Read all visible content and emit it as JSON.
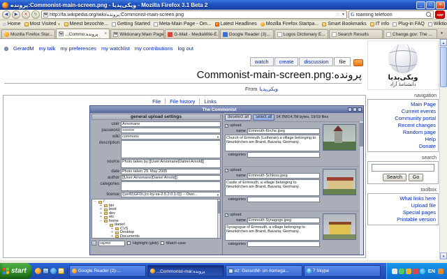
{
  "colors": {
    "link_blue": "#002bb8",
    "titlebar_blue": "#1e50c0",
    "taskbar_blue": "#2257c5",
    "start_green": "#2f8b29",
    "abp_red": "#d40000",
    "rss_orange": "#f07010"
  },
  "icons": {
    "wikipedia": "W",
    "google": "G",
    "skype": "S",
    "back": "◀",
    "forward": "▶",
    "reload": "↻",
    "stop": "✕",
    "dropdown": "▼",
    "star": "☆",
    "home": "⌂",
    "overflow": "»",
    "tab_list": "▼",
    "close": "×",
    "scroll_up": "▲",
    "scroll_down": "▼",
    "check": "✓",
    "minimize": "_",
    "maximize": "□",
    "win_close": "✕"
  },
  "window": {
    "title": "پرونده:Commonist-main-screen.png - ویکی‌پدیا - Mozilla Firefox 3.1 Beta 2"
  },
  "nav": {
    "url": "http://fa.wikipedia.org/wiki/پرونده:Commonist-main-screen.png",
    "search_value": "roaming telefoon",
    "abp": "ABP"
  },
  "bookmarks": {
    "items": [
      {
        "label": "Home"
      },
      {
        "label": "Most Visited"
      },
      {
        "label": "Meest bezochte..."
      },
      {
        "label": "Getting Started"
      },
      {
        "label": "Meta-Main Page - Om..."
      },
      {
        "label": "Latest Headlines"
      },
      {
        "label": "Mozilla Firefox Startpa..."
      },
      {
        "label": "Smart Bookmarks"
      },
      {
        "label": "IT info"
      },
      {
        "label": "Plug-in FAQ"
      },
      {
        "label": "WiktionaryZ"
      }
    ]
  },
  "tabs": {
    "items": [
      {
        "label": "Mozilla Firefox Star..."
      },
      {
        "label": "پرونده:Commo..."
      },
      {
        "label": "Wiktionary:Main Page..."
      },
      {
        "label": "G-Mail - MediaWiki-E..."
      },
      {
        "label": "Google Reader (3)..."
      },
      {
        "label": "Logos Dictionary E..."
      },
      {
        "label": "Search Results"
      },
      {
        "label": "Change.gov: The ..."
      }
    ]
  },
  "page": {
    "personal": [
      "GerardM",
      "my talk",
      "my preferences",
      "my watchlist",
      "my contributions",
      "log out"
    ],
    "content_tabs": [
      "watch",
      "create",
      "discussion",
      "file"
    ],
    "title": "پرونده:Commonist-main-screen.png",
    "from_label": "From",
    "site_name": "ویکی‌پدیا",
    "file_links": [
      "File",
      "File history",
      "Links"
    ]
  },
  "sidebar": {
    "wordmark": "ویکی‌پدیا",
    "tagline": "دانشنامهٔ آزاد",
    "nav_title": "navigation",
    "nav_items": [
      "Main Page",
      "Current events",
      "Community portal",
      "Recent changes",
      "Random page",
      "Help",
      "Donate"
    ],
    "search_title": "search",
    "search_button": "Search",
    "go_button": "Go",
    "toolbox_title": "toolbox",
    "toolbox_items": [
      "What links here",
      "Upload file",
      "Special pages",
      "Printable version"
    ]
  },
  "commonist": {
    "title": "The Commonist",
    "settings_header": "general upload settings",
    "fields": [
      {
        "label": "user",
        "value": "Arnomane"
      },
      {
        "label": "password",
        "value": "•••••••••"
      },
      {
        "label": "wiki",
        "value": "commons"
      },
      {
        "label": "description",
        "value": ""
      },
      {
        "label": "source",
        "value": "Photo taken by [[User:Arnomane|Daniel Arnold]]"
      },
      {
        "label": "date",
        "value": "Photo taken 29. May 2005"
      },
      {
        "label": "author",
        "value": "[[User:Arnomane|Daniel Arnold]]"
      },
      {
        "label": "categories",
        "value": ""
      },
      {
        "label": "license",
        "value": "{{self2|GFDL|cc-by-sa-2.5,2.0,1.0}} -- Own..."
      }
    ],
    "tree": [
      {
        "label": "/",
        "knob": "−"
      },
      {
        "label": "bin",
        "knob": "+"
      },
      {
        "label": "boot",
        "knob": "+"
      },
      {
        "label": "dev",
        "knob": "+"
      },
      {
        "label": "etc",
        "knob": "+"
      },
      {
        "label": "home",
        "knob": "−"
      },
      {
        "label": "daniel",
        "knob": "−"
      },
      {
        "label": "CVS",
        "knob": "+"
      },
      {
        "label": "Desktop",
        "knob": "+"
      },
      {
        "label": "Documents",
        "knob": "+"
      }
    ],
    "filter": {
      "value": "raymo",
      "highlight_label": "Highlight (glob)",
      "match_label": "Match case"
    },
    "toolbar": {
      "deselect_all": "deselect all",
      "select_all": "select all",
      "status": "14.7M/14.7M bytes, 19/19 files"
    },
    "labels": {
      "upload": "upload",
      "name": "name",
      "categories": "categories"
    },
    "files": [
      {
        "name": "Ermreuth-Kirche.jpeg",
        "description": "Church of Ermreuth (Lutheran) a village belonging to Neunkirchen am Brand, Bavaria, Germany."
      },
      {
        "name": "Ermreuth-Schloss.jpeg",
        "description": "Castle of Ermreuth, a village belonging to Neunkirchen am Brand, Bavaria, Germany."
      },
      {
        "name": "Ermreuth-Synagoge.jpeg",
        "description": "Synagogue of Ermreuth, a village belonging to Neunkirchen am Brand, Bavaria, Germany."
      }
    ]
  },
  "taskbar": {
    "start": "start",
    "tasks": [
      {
        "label": "Google Reader (2)-..."
      },
      {
        "label": "پرونده:Commonist-mai..."
      },
      {
        "label": "ez: GerardM- on #omega..."
      },
      {
        "label": "7 Skype"
      }
    ],
    "language": "EN"
  }
}
